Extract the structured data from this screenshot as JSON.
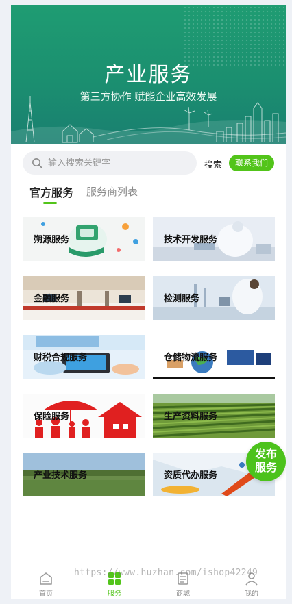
{
  "banner": {
    "title": "产业服务",
    "subtitle": "第三方协作 赋能企业高效发展"
  },
  "search": {
    "placeholder": "输入搜索关键字",
    "button_label": "搜索",
    "contact_label": "联系我们",
    "icon": "search-icon"
  },
  "tabs": [
    {
      "label": "官方服务",
      "active": true
    },
    {
      "label": "服务商列表",
      "active": false
    }
  ],
  "services": [
    {
      "label": "朔源服务"
    },
    {
      "label": "技术开发服务"
    },
    {
      "label": "金融服务"
    },
    {
      "label": "检测服务"
    },
    {
      "label": "财税合规服务"
    },
    {
      "label": "仓储物流服务"
    },
    {
      "label": "保险服务"
    },
    {
      "label": "生产资料服务"
    },
    {
      "label": "产业技术服务"
    },
    {
      "label": "资质代办服务"
    }
  ],
  "publish_button": {
    "line1": "发布",
    "line2": "服务"
  },
  "watermark": "https://www.huzhan.com/ishop42249",
  "bottom_nav": [
    {
      "label": "首页",
      "icon": "home-icon",
      "active": false
    },
    {
      "label": "服务",
      "icon": "grid-icon",
      "active": true
    },
    {
      "label": "商城",
      "icon": "store-icon",
      "active": false
    },
    {
      "label": "我的",
      "icon": "user-icon",
      "active": false
    }
  ],
  "colors": {
    "accent": "#52c41a",
    "banner": "#1f9c72",
    "background": "#eef1f6"
  }
}
